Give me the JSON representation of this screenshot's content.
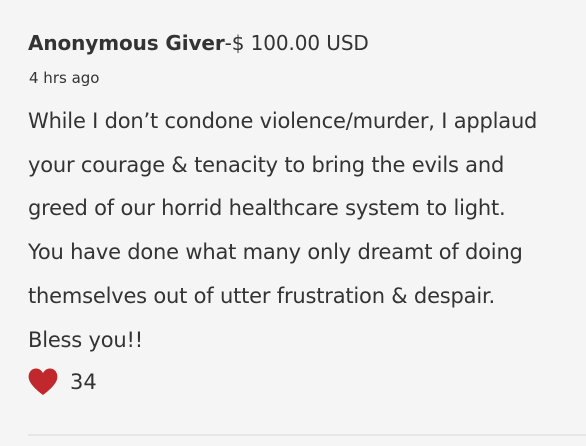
{
  "comment": {
    "author": "Anonymous Giver",
    "amount": "-$ 100.00 USD",
    "time": "4 hrs ago",
    "message_lines": [
      "While I don’t condone violence/murder, I applaud",
      "your courage & tenacity to bring the evils and",
      "greed of our horrid healthcare system to light.",
      "You have done what many only dreamt of doing",
      "themselves out of utter frustration & despair.",
      "Bless you!!"
    ],
    "likes": "34",
    "like_icon": "heart-icon"
  },
  "colors": {
    "background": "#f5f5f5",
    "text": "#333333",
    "heart": "#c0282d",
    "divider": "#e6e6e6"
  }
}
